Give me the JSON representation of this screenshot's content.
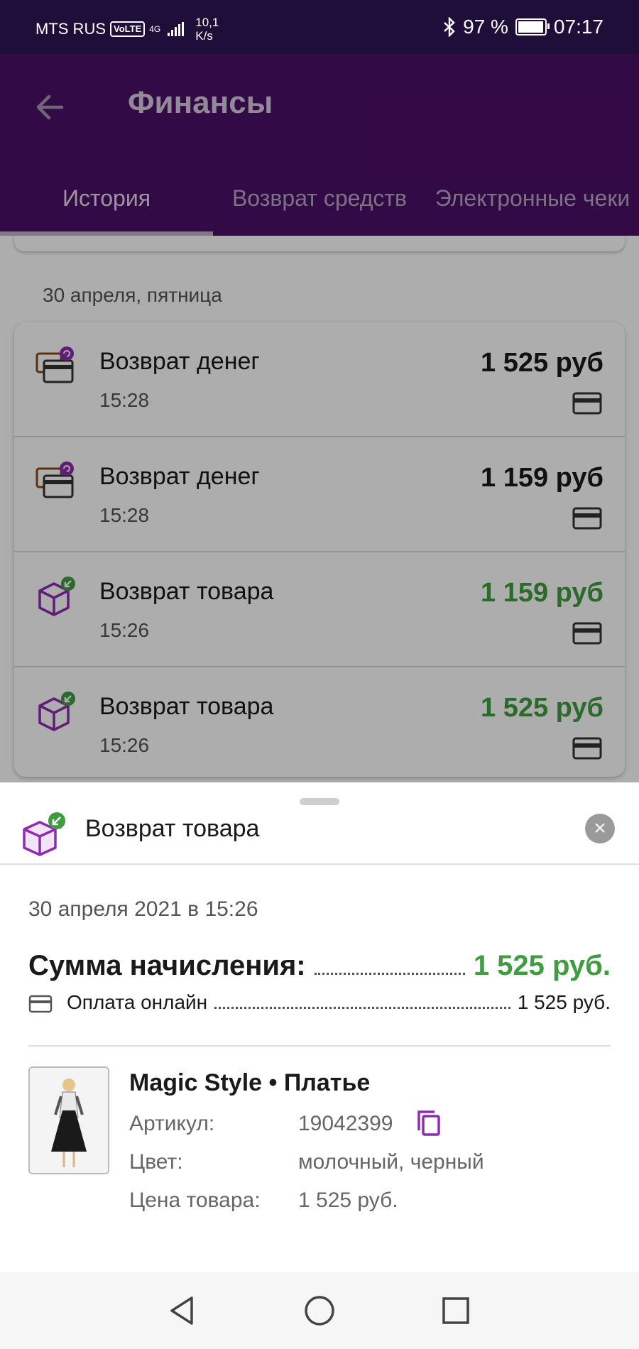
{
  "status_bar": {
    "carrier": "MTS RUS",
    "volte": "VoLTE",
    "network_type": "4G",
    "speed_value": "10,1",
    "speed_unit": "K/s",
    "battery": "97 %",
    "battery_level": 0.97,
    "time": "07:17"
  },
  "header": {
    "title": "Финансы",
    "tabs": [
      {
        "label": "История",
        "active": true
      },
      {
        "label": "Возврат средств",
        "active": false
      },
      {
        "label": "Электронные чеки",
        "active": false
      }
    ]
  },
  "history": {
    "date_heading": "30 апреля, пятница",
    "items": [
      {
        "title": "Возврат денег",
        "time": "15:28",
        "amount": "1 525 руб",
        "type": "refund",
        "amount_color": "#1a1a1a",
        "icon": "money-refund-icon"
      },
      {
        "title": "Возврат денег",
        "time": "15:28",
        "amount": "1 159 руб",
        "type": "refund",
        "amount_color": "#1a1a1a",
        "icon": "money-refund-icon"
      },
      {
        "title": "Возврат товара",
        "time": "15:26",
        "amount": "1 159 руб",
        "type": "return",
        "amount_color": "#3f9c3f",
        "icon": "product-return-icon"
      },
      {
        "title": "Возврат товара",
        "time": "15:26",
        "amount": "1 525 руб",
        "type": "return",
        "amount_color": "#3f9c3f",
        "icon": "product-return-icon"
      }
    ]
  },
  "sheet": {
    "title": "Возврат товара",
    "datetime": "30 апреля 2021 в 15:26",
    "sum_label": "Сумма начисления:",
    "sum_value": "1 525 руб.",
    "payment_label": "Оплата онлайн",
    "payment_value": "1 525 руб.",
    "product": {
      "name": "Magic Style • Платье",
      "article_label": "Артикул:",
      "article_value": "19042399",
      "color_label": "Цвет:",
      "color_value": "молочный, черный",
      "price_label": "Цена товара:",
      "price_value": "1 525 руб."
    }
  },
  "colors": {
    "header_bg": "#4b0f67",
    "accent_purple": "#8e2bb0",
    "positive_green": "#3f9c3f"
  }
}
